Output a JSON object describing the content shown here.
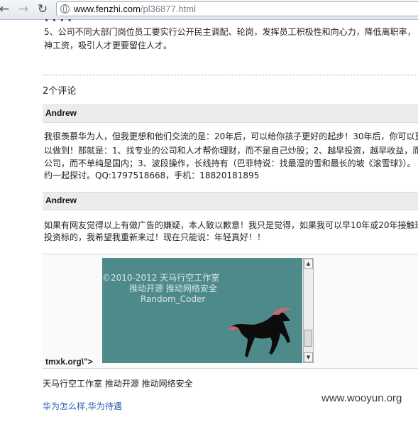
{
  "browser": {
    "url_host": "www.fenzhi.com",
    "url_path": "/pl36877.html"
  },
  "article": {
    "line1_partial": "5、公司不同大部门岗位员工要实行公开民主调配、轮岗，发挥员工积极性和向心力，降低离职率，",
    "line2": "神工资，吸引人才更要留住人才。"
  },
  "comments": {
    "title": "2个评论",
    "items": [
      {
        "author": "Andrew",
        "lines": [
          "我很羡慕华为人，但我更想和他们交流的是：20年后，可以给你孩子更好的起步！30年后，你可以更",
          "以做到！那就是：1、找专业的公司和人才帮你理财，而不是自己炒股；2、越早投资，越早收益，而",
          "公司，而不单纯是国内；3、波段操作，长线持有（巴菲特说：找最湿的雪和最长的坡《滚雪球》）。",
          "约一起探讨。QQ:1797518668，手机：18820181895"
        ]
      },
      {
        "author": "Andrew",
        "lines": [
          "如果有网友觉得以上有做广告的嫌疑，本人致以歉意！我只是觉得，如果我可以早10年或20年接触理",
          "投资标的，我希望我重新来过！现在只能说：年轻真好！！"
        ]
      }
    ]
  },
  "embed": {
    "line1": "©2010-2012  天马行空工作室",
    "line2": "推动开源   推动网络安全",
    "line3": "Random_Coder",
    "injected_text": "tmxk.org\\\">",
    "caption": "天马行空工作室 推动开源 推动网络安全"
  },
  "related": {
    "link1": "华为怎么样",
    "separator": ",",
    "link2": "华为待遇"
  },
  "watermark": "www.wooyun.org"
}
